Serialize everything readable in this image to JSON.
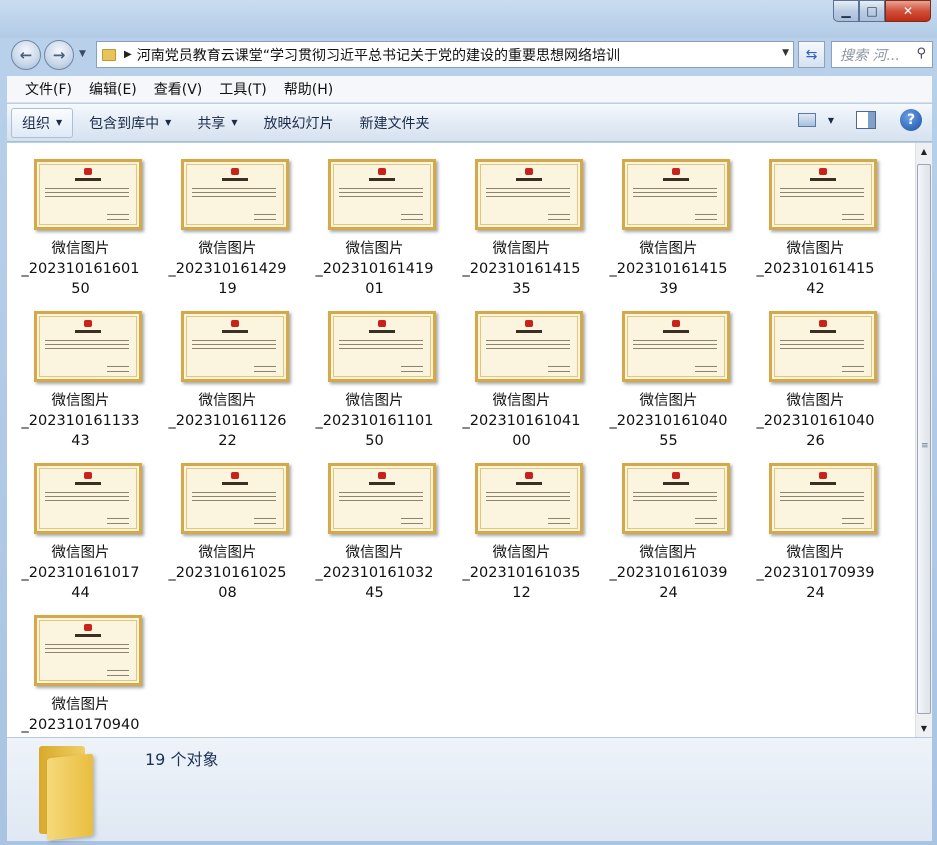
{
  "window": {
    "minimize_glyph": "▁",
    "maximize_glyph": "□",
    "close_glyph": "✕"
  },
  "address": {
    "back_glyph": "←",
    "forward_glyph": "→",
    "path": "河南党员教育云课堂“学习贯彻习近平总书记关于党的建设的重要思想网络培训",
    "search_placeholder": "搜索 河..."
  },
  "menu": [
    "文件(F)",
    "编辑(E)",
    "查看(V)",
    "工具(T)",
    "帮助(H)"
  ],
  "toolbar": {
    "organize": "组织",
    "include_library": "包含到库中",
    "share": "共享",
    "slideshow": "放映幻灯片",
    "new_folder": "新建文件夹",
    "help": "?"
  },
  "files": [
    {
      "line1": "微信图片",
      "line2": "_202310161601",
      "line3": "50"
    },
    {
      "line1": "微信图片",
      "line2": "_202310161429",
      "line3": "19"
    },
    {
      "line1": "微信图片",
      "line2": "_202310161419",
      "line3": "01"
    },
    {
      "line1": "微信图片",
      "line2": "_202310161415",
      "line3": "35"
    },
    {
      "line1": "微信图片",
      "line2": "_202310161415",
      "line3": "39"
    },
    {
      "line1": "微信图片",
      "line2": "_202310161415",
      "line3": "42"
    },
    {
      "line1": "微信图片",
      "line2": "_202310161133",
      "line3": "43"
    },
    {
      "line1": "微信图片",
      "line2": "_202310161126",
      "line3": "22"
    },
    {
      "line1": "微信图片",
      "line2": "_202310161101",
      "line3": "50"
    },
    {
      "line1": "微信图片",
      "line2": "_202310161041",
      "line3": "00"
    },
    {
      "line1": "微信图片",
      "line2": "_202310161040",
      "line3": "55"
    },
    {
      "line1": "微信图片",
      "line2": "_202310161040",
      "line3": "26"
    },
    {
      "line1": "微信图片",
      "line2": "_202310161017",
      "line3": "44"
    },
    {
      "line1": "微信图片",
      "line2": "_202310161025",
      "line3": "08"
    },
    {
      "line1": "微信图片",
      "line2": "_202310161032",
      "line3": "45"
    },
    {
      "line1": "微信图片",
      "line2": "_202310161035",
      "line3": "12"
    },
    {
      "line1": "微信图片",
      "line2": "_202310161039",
      "line3": "24"
    },
    {
      "line1": "微信图片",
      "line2": "_202310170939",
      "line3": "24"
    },
    {
      "line1": "微信图片",
      "line2": "_202310170940",
      "line3": ""
    }
  ],
  "status": {
    "count_text": "19 个对象"
  }
}
